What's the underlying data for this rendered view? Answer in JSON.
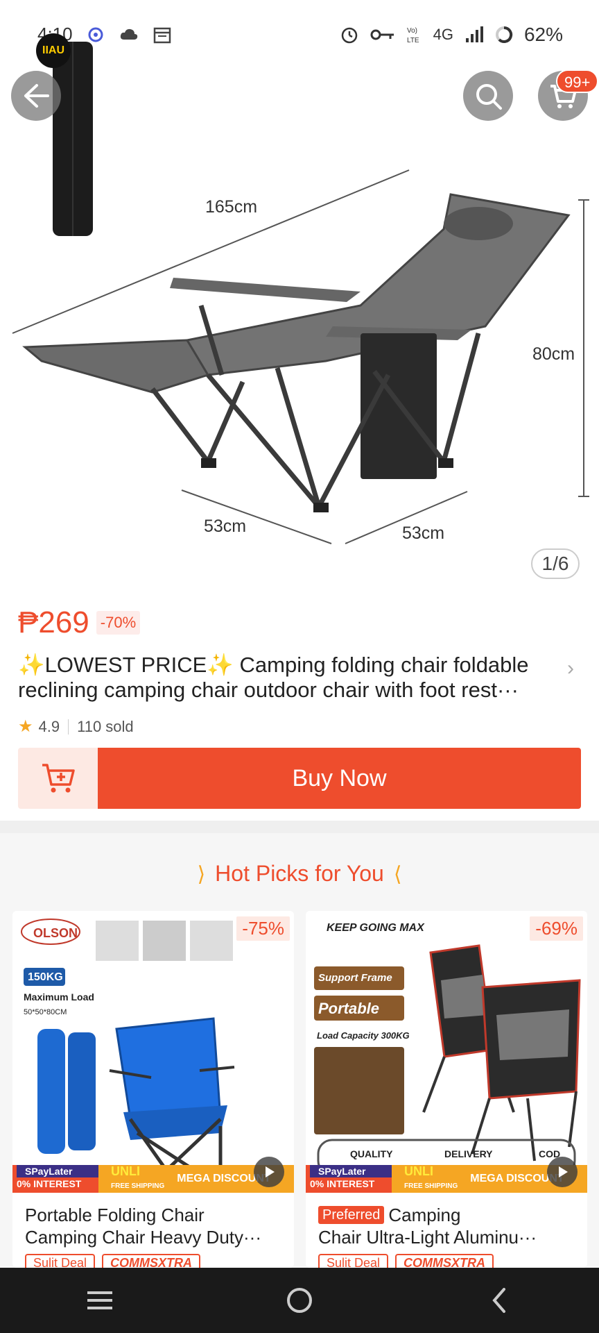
{
  "status_bar": {
    "time": "4:10",
    "battery": "62%",
    "network": "4G"
  },
  "header": {
    "cart_badge": "99+",
    "brand_badge": "IIAU"
  },
  "product": {
    "image_counter": "1/6",
    "dimensions": {
      "length": "165cm",
      "height": "80cm",
      "width_left": "53cm",
      "width_right": "53cm"
    },
    "price": "₱269",
    "discount": "-70%",
    "title_line1": "✨LOWEST PRICE✨ Camping folding chair foldable",
    "title_line2": "reclining camping chair outdoor chair with foot rest···",
    "rating": "4.9",
    "sold": "110 sold"
  },
  "actions": {
    "buy_now": "Buy Now"
  },
  "hot_picks": {
    "title": "Hot Picks for You",
    "items": [
      {
        "discount": "-75%",
        "title_line1": "Portable Folding Chair",
        "title_line2": "Camping Chair Heavy Duty···",
        "brand": "OLSON",
        "image_text_load": "150KG",
        "image_text_max": "Maximum Load",
        "image_text_size": "50*50*80CM",
        "tag1": "Sulit Deal",
        "tag2": "COMMSXTRA"
      },
      {
        "discount": "-69%",
        "preferred": "Preferred",
        "title_line1": "Camping",
        "title_line2": "Chair Ultra-Light Aluminu···",
        "brand": "KEEP GOING MAX",
        "image_text_support": "Support Frame",
        "image_text_portable": "Portable",
        "image_text_load": "Load Capacity 300KG",
        "image_text_quality": "QUALITY",
        "image_text_delivery": "DELIVERY",
        "image_text_cod": "COD",
        "tag1": "Sulit Deal",
        "tag2": "COMMSXTRA"
      }
    ],
    "promo": {
      "spay_top": "SPayLater",
      "spay_bottom": "0% INTEREST",
      "unli": "UNLI",
      "unli_sub": "FREE SHIPPING",
      "mega": "MEGA DISCOUNT"
    }
  },
  "colors": {
    "accent": "#ee4d2d",
    "star": "#f5a623"
  }
}
